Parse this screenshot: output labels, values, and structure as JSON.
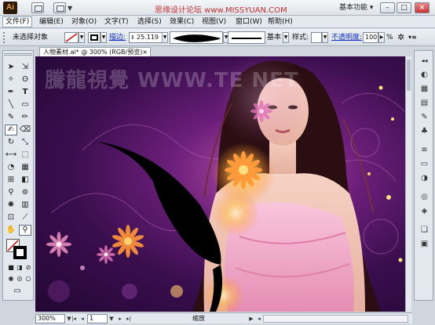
{
  "app": {
    "logo": "Ai",
    "watermark_text": "思缘设计论坛 www.MISSYUAN.COM",
    "workspace": "基本功能"
  },
  "window_controls": {
    "minimize": "–",
    "restore": "□",
    "close": "×"
  },
  "menu": {
    "items": [
      "文件(F)",
      "编辑(E)",
      "对象(O)",
      "文字(T)",
      "选择(S)",
      "效果(C)",
      "视图(V)",
      "窗口(W)",
      "帮助(H)"
    ]
  },
  "control_bar": {
    "selection_label": "未选择对象",
    "stroke_link": "描边:",
    "stroke_width": "25.119",
    "brush_label": "基本",
    "style_label": "样式:",
    "opacity_link": "不透明度:",
    "opacity_value": "100",
    "opacity_unit": "%"
  },
  "document": {
    "tab_title": "人物素材.ai* @ 300% (RGB/预览)",
    "tab_close": "×",
    "canvas_watermark": "騰龍視覺 WWW.TE NET"
  },
  "status": {
    "zoom": "300%",
    "page": "1",
    "label": "缩放"
  },
  "colors": {
    "canvas_dark": "#220733",
    "canvas_purple": "#6a1e78",
    "flower_orange": "#f08a3a",
    "dress_pink": "#f2a8c8"
  }
}
